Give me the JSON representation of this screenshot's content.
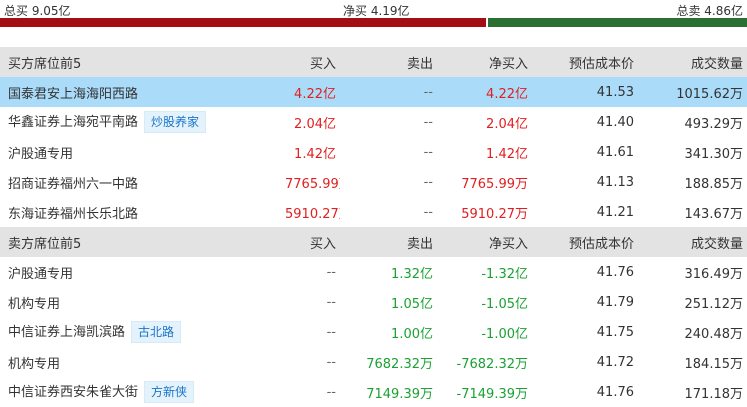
{
  "summary": {
    "total_buy": "总买 9.05亿",
    "net_buy": "净买 4.19亿",
    "total_sell": "总卖 4.86亿",
    "buy_fraction": 0.65,
    "colors": {
      "buy": "#a30d14",
      "sell": "#2a7033"
    }
  },
  "buy_section": {
    "headers": [
      "买方席位前5",
      "买入",
      "卖出",
      "净买入",
      "预估成本价",
      "成交数量"
    ],
    "rows": [
      {
        "name": "国泰君安上海海阳西路",
        "tag": "",
        "buy": "4.22亿",
        "sell": "--",
        "net": "4.22亿",
        "cost": "41.53",
        "volume": "1015.62万",
        "highlighted": true
      },
      {
        "name": "华鑫证券上海宛平南路",
        "tag": "炒股养家",
        "buy": "2.04亿",
        "sell": "--",
        "net": "2.04亿",
        "cost": "41.40",
        "volume": "493.29万"
      },
      {
        "name": "沪股通专用",
        "tag": "",
        "buy": "1.42亿",
        "sell": "--",
        "net": "1.42亿",
        "cost": "41.61",
        "volume": "341.30万"
      },
      {
        "name": "招商证券福州六一中路",
        "tag": "",
        "buy": "7765.99万",
        "sell": "--",
        "net": "7765.99万",
        "cost": "41.13",
        "volume": "188.85万"
      },
      {
        "name": "东海证券福州长乐北路",
        "tag": "",
        "buy": "5910.27万",
        "sell": "--",
        "net": "5910.27万",
        "cost": "41.21",
        "volume": "143.67万"
      }
    ]
  },
  "sell_section": {
    "headers": [
      "卖方席位前5",
      "买入",
      "卖出",
      "净买入",
      "预估成本价",
      "成交数量"
    ],
    "rows": [
      {
        "name": "沪股通专用",
        "tag": "",
        "buy": "--",
        "sell": "1.32亿",
        "net": "-1.32亿",
        "cost": "41.76",
        "volume": "316.49万"
      },
      {
        "name": "机构专用",
        "tag": "",
        "buy": "--",
        "sell": "1.05亿",
        "net": "-1.05亿",
        "cost": "41.79",
        "volume": "251.12万"
      },
      {
        "name": "中信证券上海凯滨路",
        "tag": "古北路",
        "buy": "--",
        "sell": "1.00亿",
        "net": "-1.00亿",
        "cost": "41.75",
        "volume": "240.48万"
      },
      {
        "name": "机构专用",
        "tag": "",
        "buy": "--",
        "sell": "7682.32万",
        "net": "-7682.32万",
        "cost": "41.72",
        "volume": "184.15万"
      },
      {
        "name": "中信证券西安朱雀大街",
        "tag": "方新侠",
        "buy": "--",
        "sell": "7149.39万",
        "net": "-7149.39万",
        "cost": "41.76",
        "volume": "171.18万"
      }
    ]
  }
}
